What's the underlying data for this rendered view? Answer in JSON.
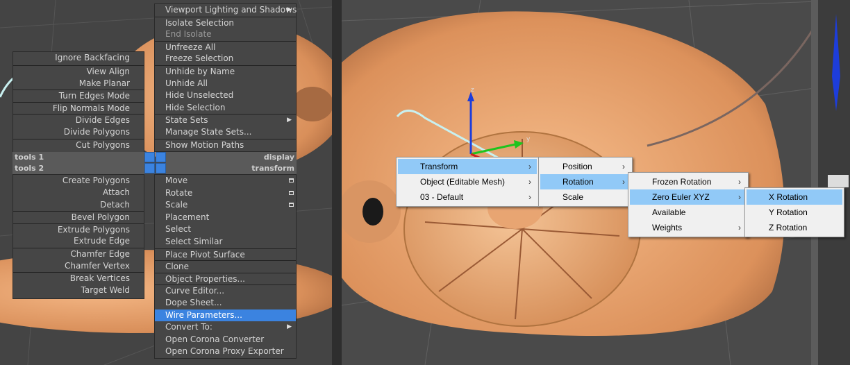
{
  "quad_left": {
    "items": [
      {
        "label": "Ignore Backfacing"
      },
      {
        "label": "View Align"
      },
      {
        "label": "Make Planar"
      },
      {
        "label": "Turn Edges Mode"
      },
      {
        "label": "Flip Normals Mode"
      },
      {
        "label": "Divide Edges"
      },
      {
        "label": "Divide Polygons"
      },
      {
        "label": "Cut Polygons"
      }
    ],
    "items_bottom": [
      {
        "label": "Create Polygons"
      },
      {
        "label": "Attach"
      },
      {
        "label": "Detach"
      },
      {
        "label": "Bevel Polygon"
      },
      {
        "label": "Extrude Polygons"
      },
      {
        "label": "Extrude Edge"
      },
      {
        "label": "Chamfer Edge"
      },
      {
        "label": "Chamfer Vertex"
      },
      {
        "label": "Break Vertices"
      },
      {
        "label": "Target Weld"
      }
    ],
    "header_tools1": "tools 1",
    "header_tools2": "tools 2"
  },
  "quad_right": {
    "items_top": [
      {
        "label": "Viewport Lighting and Shadows"
      },
      {
        "label": "Isolate Selection"
      },
      {
        "label": "End Isolate"
      },
      {
        "label": "Unfreeze All"
      },
      {
        "label": "Freeze Selection"
      },
      {
        "label": "Unhide by Name"
      },
      {
        "label": "Unhide All"
      },
      {
        "label": "Hide Unselected"
      },
      {
        "label": "Hide Selection"
      },
      {
        "label": "State Sets"
      },
      {
        "label": "Manage State Sets..."
      },
      {
        "label": "Show Motion Paths"
      }
    ],
    "header_display": "display",
    "header_transform": "transform",
    "items_bottom": [
      {
        "label": "Move"
      },
      {
        "label": "Rotate"
      },
      {
        "label": "Scale"
      },
      {
        "label": "Placement"
      },
      {
        "label": "Select"
      },
      {
        "label": "Select Similar"
      },
      {
        "label": "Place Pivot Surface"
      },
      {
        "label": "Clone"
      },
      {
        "label": "Object Properties..."
      },
      {
        "label": "Curve Editor..."
      },
      {
        "label": "Dope Sheet..."
      },
      {
        "label": "Wire Parameters..."
      },
      {
        "label": "Convert To:"
      },
      {
        "label": "Open Corona Converter"
      },
      {
        "label": "Open Corona Proxy Exporter"
      }
    ]
  },
  "context_menu_1": [
    "Transform",
    "Object (Editable Mesh)",
    "03 - Default"
  ],
  "context_menu_2": [
    "Position",
    "Rotation",
    "Scale"
  ],
  "context_menu_3": [
    "Frozen Rotation",
    "Zero Euler XYZ",
    "Available",
    "Weights"
  ],
  "context_menu_4": [
    "X Rotation",
    "Y Rotation",
    "Z Rotation"
  ],
  "gizmo": {
    "x": "x",
    "y": "y",
    "z": "z"
  },
  "colors": {
    "highlight_quad": "#3b83e0",
    "highlight_menu": "#91c9f7",
    "object": "#e0a06a"
  }
}
